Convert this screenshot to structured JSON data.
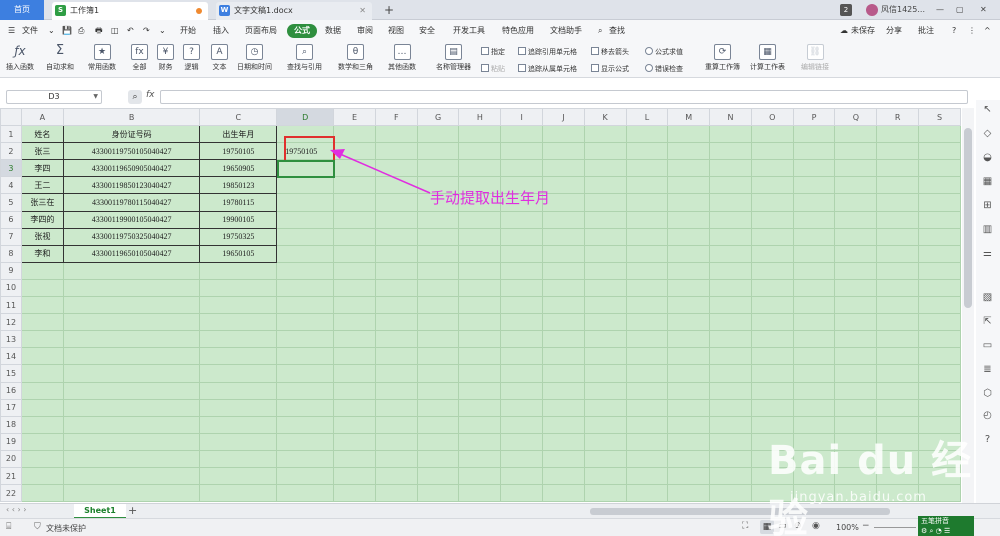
{
  "tabs": {
    "home": "首页",
    "workbook": "工作簿1",
    "writer": "文字文稿1.docx",
    "user": "风信1425...",
    "window_count": "2"
  },
  "menu": {
    "file": "文件",
    "items": [
      "开始",
      "插入",
      "页面布局",
      "公式",
      "数据",
      "审阅",
      "视图",
      "安全",
      "开发工具",
      "特色应用",
      "文档助手",
      "查找"
    ],
    "unsaved": "未保存",
    "share": "分享",
    "comment": "批注"
  },
  "ribbon": {
    "insert_func": "插入函数",
    "autosum": "自动求和",
    "common": "常用函数",
    "all": "全部",
    "finance": "财务",
    "logic": "逻辑",
    "text": "文本",
    "datetime": "日期和时间",
    "lookup": "查找与引用",
    "math": "数学和三角",
    "other": "其他函数",
    "name_mgr": "名称管理器",
    "specify": "指定",
    "paste": "粘贴",
    "trace_prec": "追踪引用单元格",
    "trace_dep": "追踪从属单元格",
    "remove_arrows": "移去箭头",
    "show_formula": "显示公式",
    "eval": "公式求值",
    "error_check": "错误检查",
    "recalc_book": "重算工作簿",
    "calc_sheet": "计算工作表",
    "edit_link": "编辑链接"
  },
  "formula_bar": {
    "cell_ref": "D3",
    "fx": "fx",
    "content": ""
  },
  "grid": {
    "columns": [
      "A",
      "B",
      "C",
      "D",
      "E",
      "F",
      "G",
      "H",
      "I",
      "J",
      "K",
      "L",
      "M",
      "N",
      "O",
      "P",
      "Q",
      "R",
      "S"
    ],
    "row_count": 22,
    "header_row": [
      "姓名",
      "身份证号码",
      "出生年月"
    ],
    "rows": [
      [
        "张三",
        "433001197501050404​27",
        "19750105"
      ],
      [
        "李四",
        "433001196509050404​27",
        "19650905"
      ],
      [
        "王二",
        "433001198501230404​27",
        "19850123"
      ],
      [
        "张三在",
        "433001197801150404​27",
        "19780115"
      ],
      [
        "李四的",
        "433001199001050404​27",
        "19900105"
      ],
      [
        "张视",
        "433001197503250404​27",
        "19750325"
      ],
      [
        "李和",
        "433001196501050404​27",
        "19650105"
      ]
    ],
    "d2_value": "19750105"
  },
  "annotation": {
    "text": "手动提取出生年月",
    "color": "#e02de0"
  },
  "sheets": {
    "active": "Sheet1"
  },
  "status": {
    "protect": "文档未保护",
    "zoom": "100%"
  },
  "ime": {
    "label": "五笔拼音"
  },
  "watermark": {
    "logo": "Bai du 经验",
    "url": "jingyan.baidu.com"
  }
}
